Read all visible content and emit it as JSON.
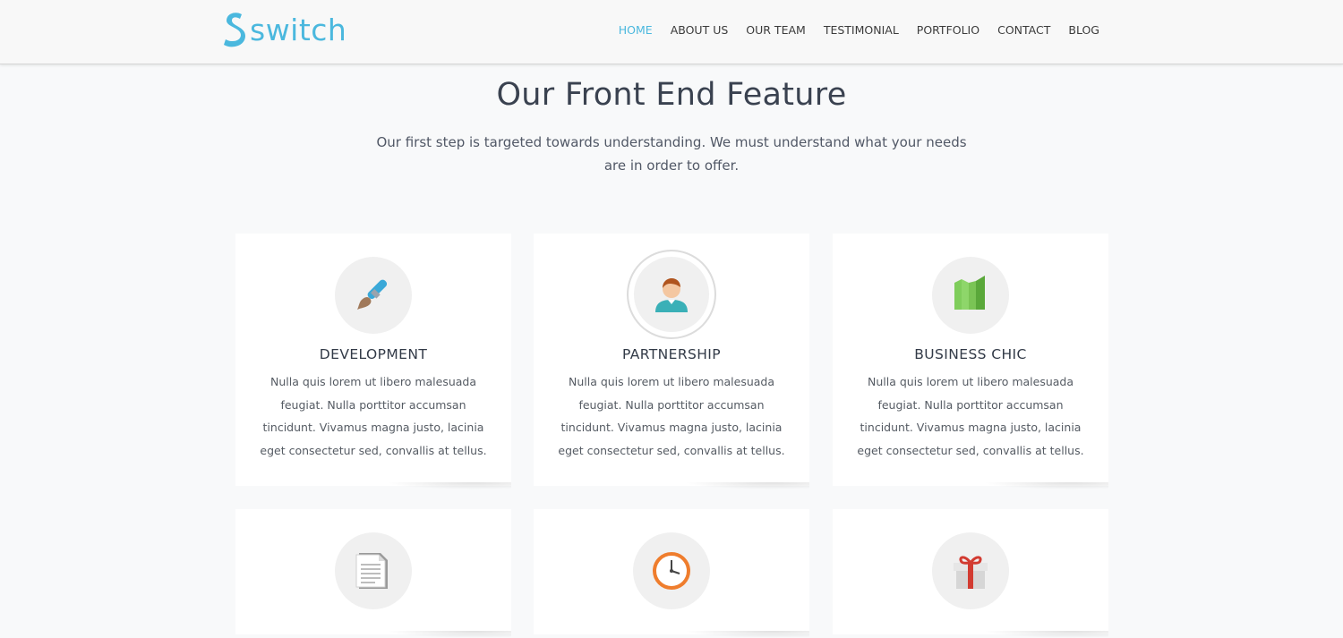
{
  "brand": {
    "name": "switch",
    "logo_icon": "s-logo-icon",
    "color": "#4bb8de"
  },
  "nav": {
    "items": [
      {
        "label": "HOME",
        "active": true
      },
      {
        "label": "ABOUT US",
        "active": false
      },
      {
        "label": "OUR TEAM",
        "active": false
      },
      {
        "label": "TESTIMONIAL",
        "active": false
      },
      {
        "label": "PORTFOLIO",
        "active": false
      },
      {
        "label": "CONTACT",
        "active": false
      },
      {
        "label": "BLOG",
        "active": false
      }
    ]
  },
  "section": {
    "title": "Our Front End Feature",
    "subtitle": "Our first step is targeted towards understanding. We must understand what your needs are in order to offer."
  },
  "cards": [
    {
      "title": "DEVELOPMENT",
      "icon": "paintbrush-icon",
      "text": "Nulla quis lorem ut libero malesuada feugiat. Nulla porttitor accumsan tincidunt. Vivamus magna justo, lacinia eget consectetur sed, convallis at tellus."
    },
    {
      "title": "PARTNERSHIP",
      "icon": "person-icon",
      "text": "Nulla quis lorem ut libero malesuada feugiat. Nulla porttitor accumsan tincidunt. Vivamus magna justo, lacinia eget consectetur sed, convallis at tellus."
    },
    {
      "title": "BUSINESS CHIC",
      "icon": "chart-blocks-icon",
      "text": "Nulla quis lorem ut libero malesuada feugiat. Nulla porttitor accumsan tincidunt. Vivamus magna justo, lacinia eget consectetur sed, convallis at tellus."
    },
    {
      "title": "",
      "icon": "document-icon",
      "text": ""
    },
    {
      "title": "",
      "icon": "clock-icon",
      "text": ""
    },
    {
      "title": "",
      "icon": "gift-icon",
      "text": ""
    }
  ]
}
